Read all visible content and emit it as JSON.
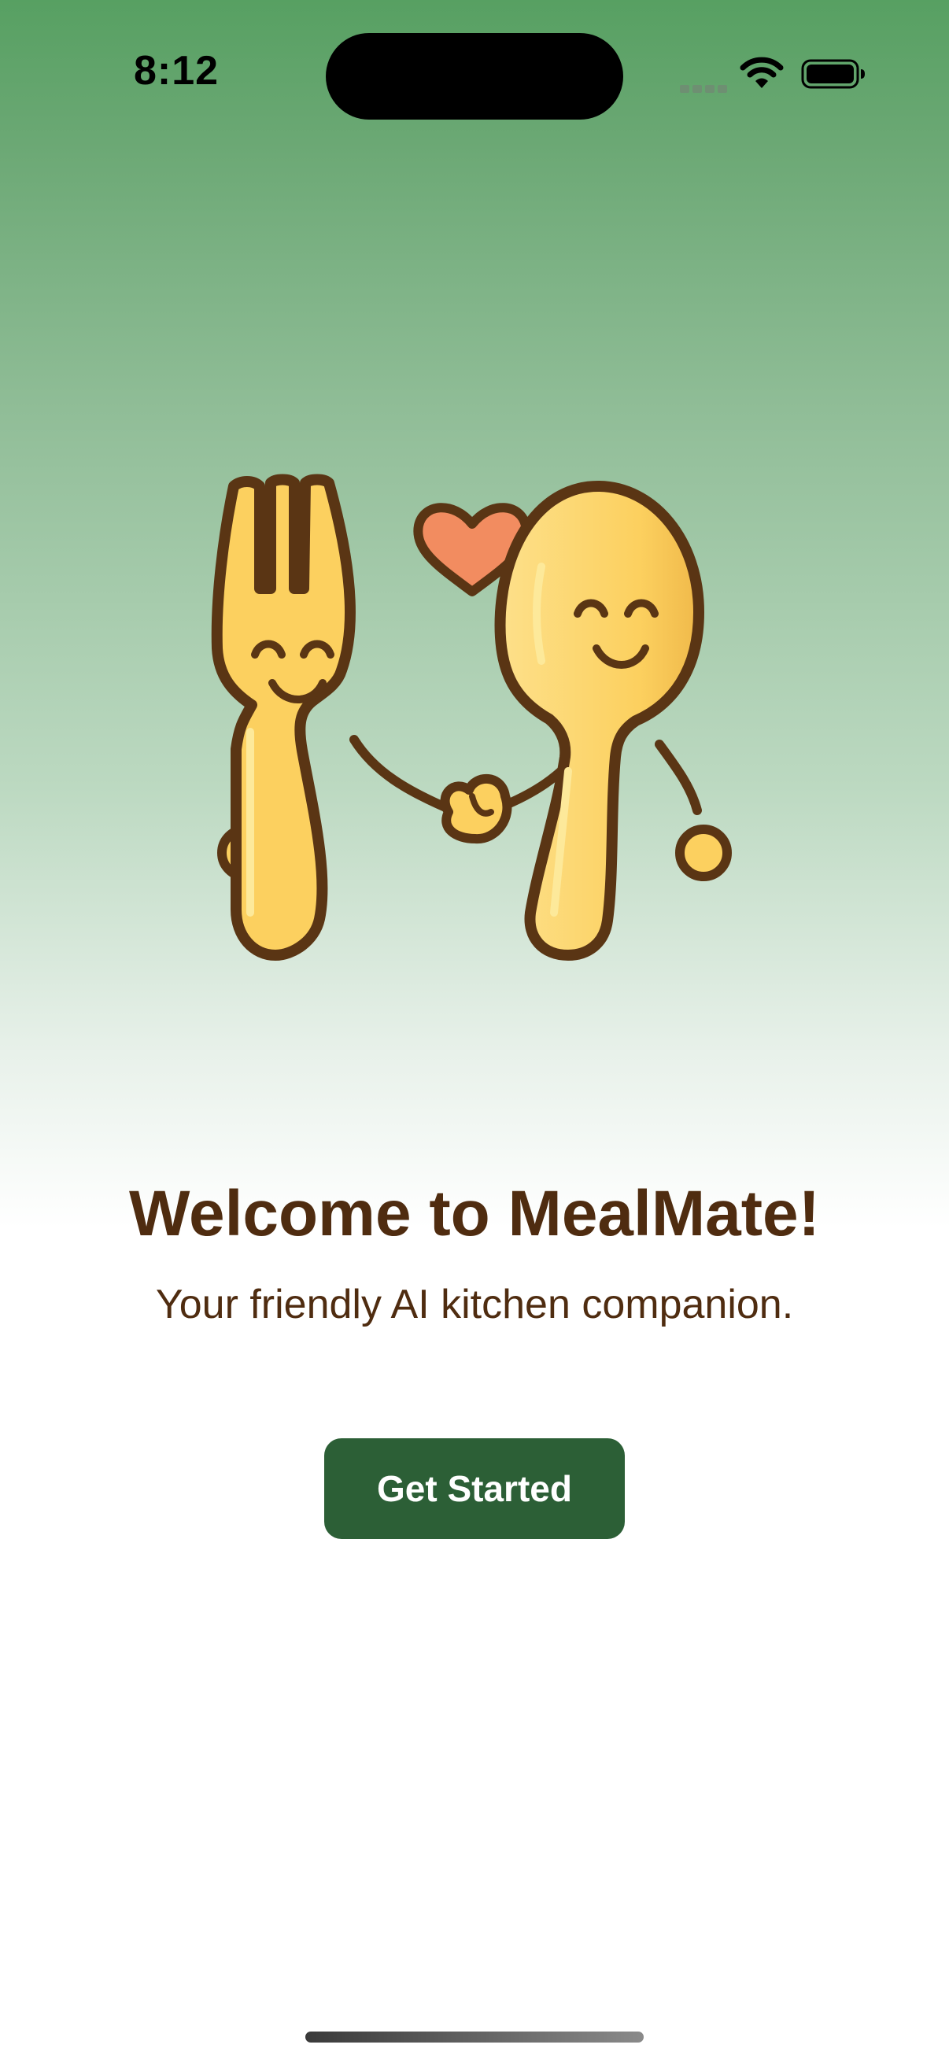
{
  "status_bar": {
    "time": "8:12"
  },
  "icons": {
    "cellular": "cellular-signal-icon",
    "wifi": "wifi-icon",
    "battery": "battery-icon",
    "mascot": "fork-and-spoon-mascot-illustration"
  },
  "welcome": {
    "title": "Welcome to MealMate!",
    "subtitle": "Your friendly AI kitchen companion.",
    "button_label": "Get Started"
  },
  "colors": {
    "gradient_top": "#57a062",
    "gradient_bottom": "#ffffff",
    "title_text": "#4f2c10",
    "button_bg": "#2c5f36",
    "button_text": "#ffffff",
    "mascot_fill": "#fcd05f",
    "mascot_outline": "#5a3514",
    "heart": "#f28c60"
  }
}
